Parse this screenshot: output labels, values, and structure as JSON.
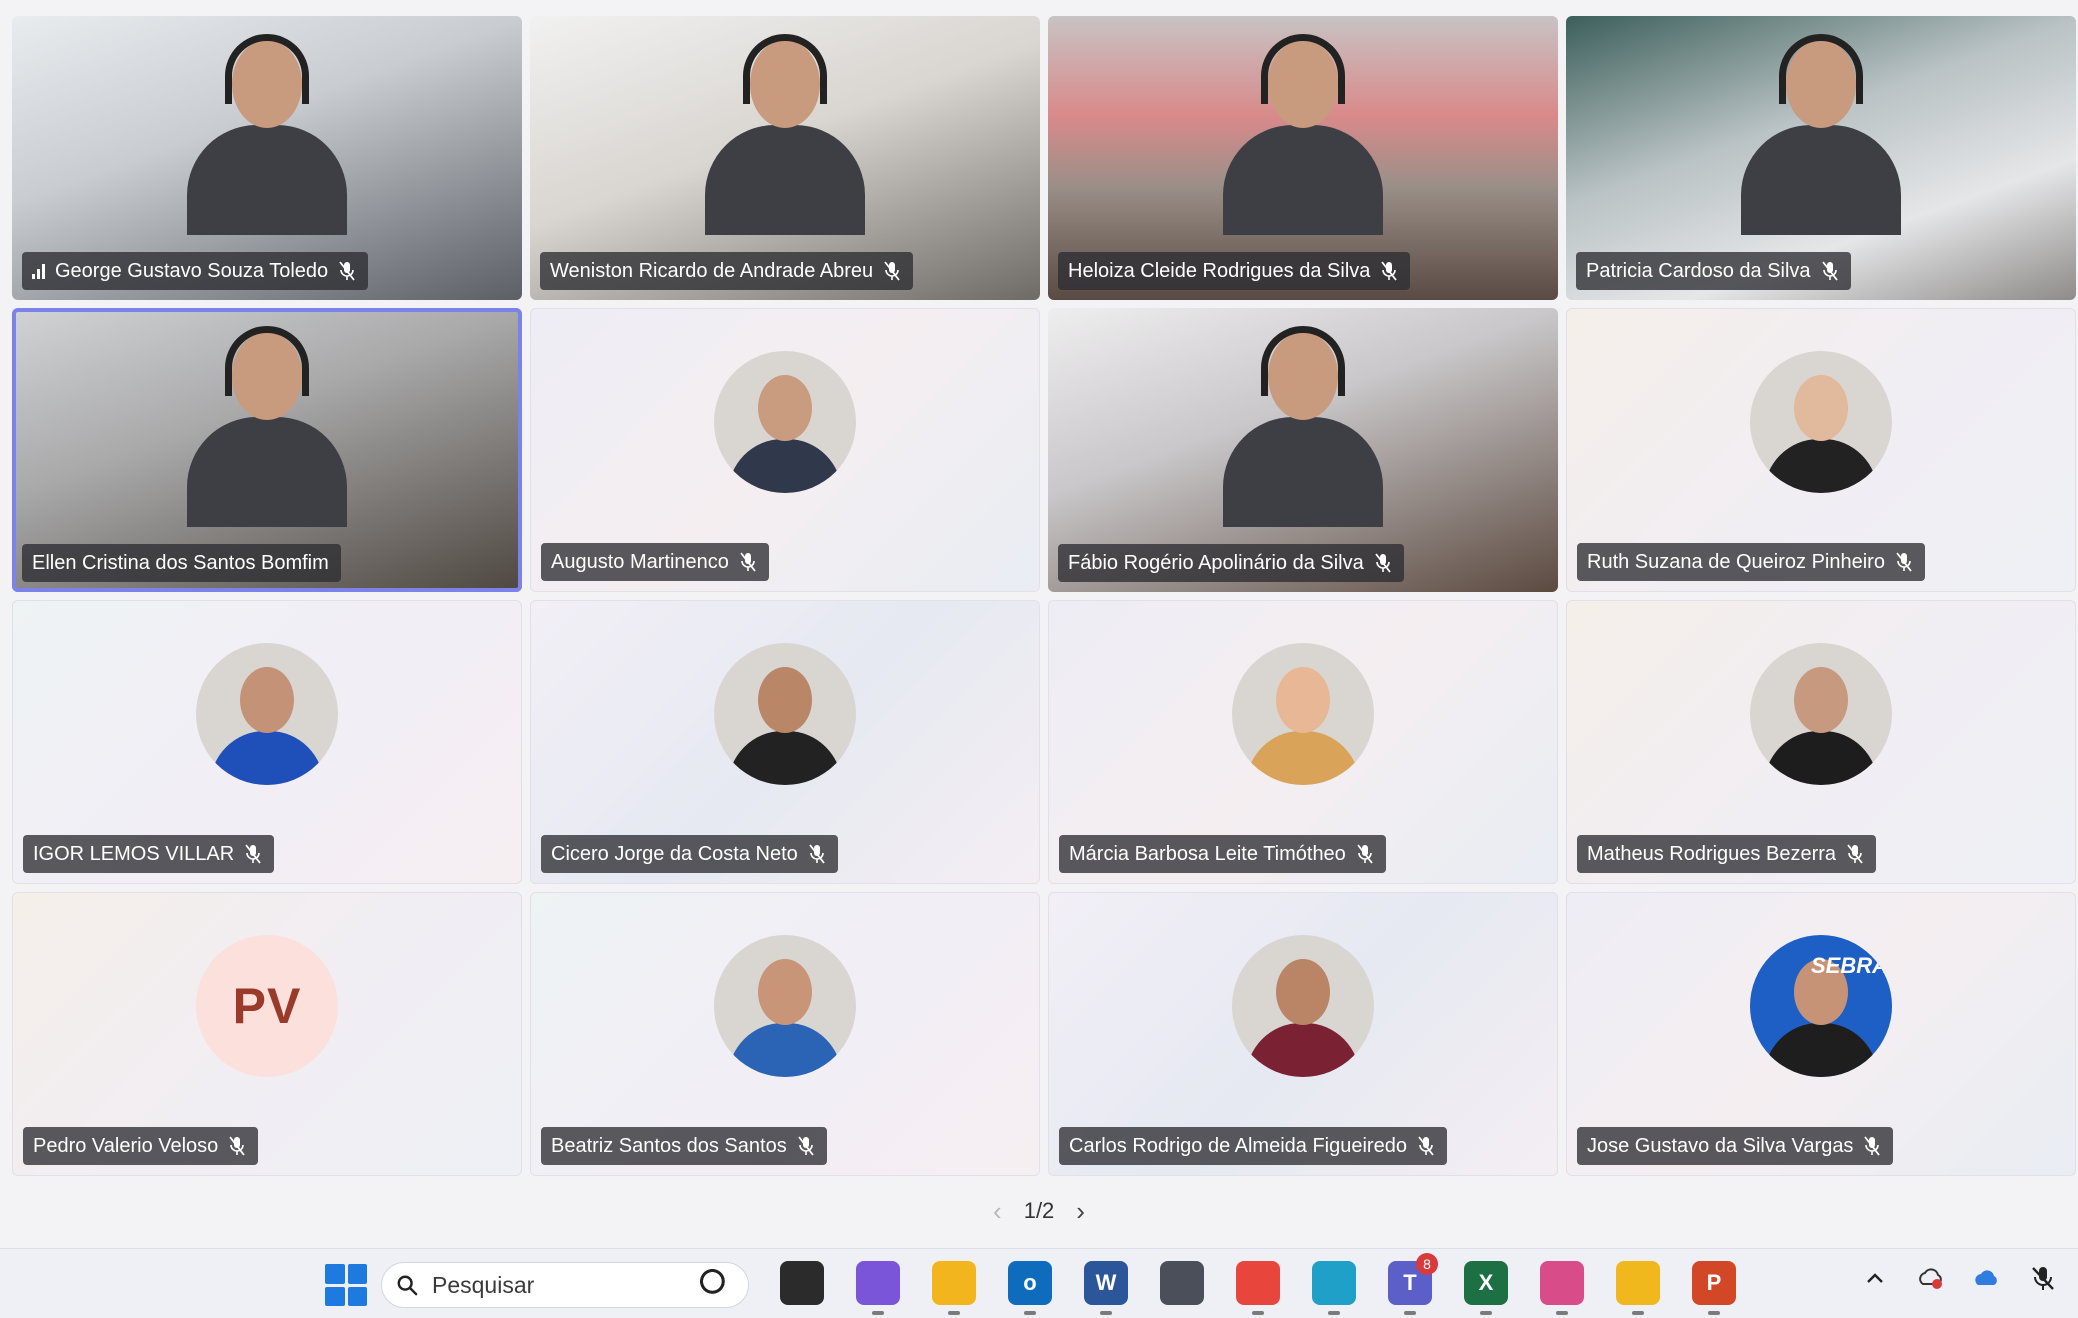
{
  "participants": [
    {
      "name": "George Gustavo Souza Toledo",
      "kind": "video",
      "style": "v0",
      "signal": true
    },
    {
      "name": "Weniston Ricardo de Andrade Abreu",
      "kind": "video",
      "style": "v1"
    },
    {
      "name": "Heloiza Cleide Rodrigues da Silva",
      "kind": "video",
      "style": "v2"
    },
    {
      "name": "Patricia Cardoso da Silva",
      "kind": "video",
      "style": "v3"
    },
    {
      "name": "Ellen Cristina dos Santos Bomfim",
      "kind": "video",
      "style": "v4",
      "speaking": true,
      "unmuted": true
    },
    {
      "name": "Augusto Martinenco",
      "kind": "avatar",
      "style": "soft1",
      "skin": "#c99b7f",
      "shirt": "#30394b"
    },
    {
      "name": "Fábio Rogério Apolinário da Silva",
      "kind": "video",
      "style": "v6"
    },
    {
      "name": "Ruth Suzana de Queiroz Pinheiro",
      "kind": "avatar",
      "style": "soft2",
      "skin": "#e1b99c",
      "shirt": "#222222"
    },
    {
      "name": "IGOR LEMOS VILLAR",
      "kind": "avatar",
      "style": "soft3",
      "skin": "#c49277",
      "shirt": "#1f4fb8"
    },
    {
      "name": "Cicero Jorge da Costa Neto",
      "kind": "avatar",
      "style": "soft0",
      "skin": "#b98668",
      "shirt": "#222222"
    },
    {
      "name": "Márcia Barbosa Leite Timótheo",
      "kind": "avatar",
      "style": "soft1",
      "skin": "#e8b896",
      "shirt": "#d9a45a"
    },
    {
      "name": "Matheus Rodrigues Bezerra",
      "kind": "avatar",
      "style": "soft2",
      "skin": "#c79a80",
      "shirt": "#1d1d1d"
    },
    {
      "name": "Pedro Valerio Veloso",
      "kind": "initials",
      "style": "soft2",
      "initials": "PV"
    },
    {
      "name": "Beatriz Santos dos Santos",
      "kind": "avatar",
      "style": "soft3",
      "skin": "#c89579",
      "shirt": "#2b63b5"
    },
    {
      "name": "Carlos Rodrigo de Almeida Figueiredo",
      "kind": "avatar",
      "style": "soft0",
      "skin": "#b98566",
      "shirt": "#7a2233"
    },
    {
      "name": "Jose Gustavo da Silva Vargas",
      "kind": "avatar",
      "style": "soft1",
      "skin": "#c69377",
      "shirt": "#1e1e1e",
      "bg": "#1d5fc4",
      "bg_text": "SEBRA"
    }
  ],
  "pager": {
    "label": "1/2",
    "prev": "‹",
    "next": "›"
  },
  "taskbar": {
    "search_placeholder": "Pesquisar",
    "teams_badge": "8",
    "apps": [
      {
        "name": "task-view",
        "color": "#2b2b2b",
        "glyph": ""
      },
      {
        "name": "m365-copilot",
        "color": "#7b55d9",
        "glyph": ""
      },
      {
        "name": "file-explorer",
        "color": "#f2b51d",
        "glyph": ""
      },
      {
        "name": "outlook",
        "color": "#0f6cbd",
        "glyph": "o"
      },
      {
        "name": "word",
        "color": "#2b579a",
        "glyph": "W"
      },
      {
        "name": "calculator",
        "color": "#4a4f5a",
        "glyph": ""
      },
      {
        "name": "chrome-profile",
        "color": "#e8453c",
        "glyph": ""
      },
      {
        "name": "edge",
        "color": "#1fa0c9",
        "glyph": ""
      },
      {
        "name": "teams",
        "color": "#5b5fc7",
        "glyph": "T"
      },
      {
        "name": "excel",
        "color": "#1d7044",
        "glyph": "X"
      },
      {
        "name": "snipping-tool",
        "color": "#d94c8a",
        "glyph": ""
      },
      {
        "name": "chrome",
        "color": "#f0b81d",
        "glyph": ""
      },
      {
        "name": "powerpoint",
        "color": "#d24726",
        "glyph": "P"
      }
    ]
  },
  "colors": {
    "speaking_outline": "#7b83eb",
    "nametag_bg": "#2d2d32",
    "initials_bg": "#fbe0dc",
    "initials_fg": "#9a3a2b"
  }
}
